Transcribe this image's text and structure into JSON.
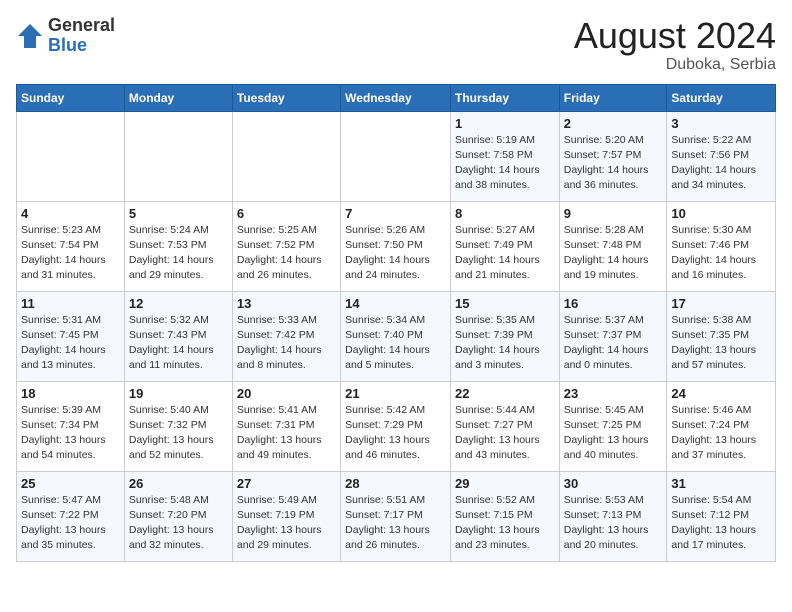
{
  "header": {
    "logo_general": "General",
    "logo_blue": "Blue",
    "month_year": "August 2024",
    "location": "Duboka, Serbia"
  },
  "days_of_week": [
    "Sunday",
    "Monday",
    "Tuesday",
    "Wednesday",
    "Thursday",
    "Friday",
    "Saturday"
  ],
  "weeks": [
    [
      {
        "day": "",
        "info": ""
      },
      {
        "day": "",
        "info": ""
      },
      {
        "day": "",
        "info": ""
      },
      {
        "day": "",
        "info": ""
      },
      {
        "day": "1",
        "info": "Sunrise: 5:19 AM\nSunset: 7:58 PM\nDaylight: 14 hours\nand 38 minutes."
      },
      {
        "day": "2",
        "info": "Sunrise: 5:20 AM\nSunset: 7:57 PM\nDaylight: 14 hours\nand 36 minutes."
      },
      {
        "day": "3",
        "info": "Sunrise: 5:22 AM\nSunset: 7:56 PM\nDaylight: 14 hours\nand 34 minutes."
      }
    ],
    [
      {
        "day": "4",
        "info": "Sunrise: 5:23 AM\nSunset: 7:54 PM\nDaylight: 14 hours\nand 31 minutes."
      },
      {
        "day": "5",
        "info": "Sunrise: 5:24 AM\nSunset: 7:53 PM\nDaylight: 14 hours\nand 29 minutes."
      },
      {
        "day": "6",
        "info": "Sunrise: 5:25 AM\nSunset: 7:52 PM\nDaylight: 14 hours\nand 26 minutes."
      },
      {
        "day": "7",
        "info": "Sunrise: 5:26 AM\nSunset: 7:50 PM\nDaylight: 14 hours\nand 24 minutes."
      },
      {
        "day": "8",
        "info": "Sunrise: 5:27 AM\nSunset: 7:49 PM\nDaylight: 14 hours\nand 21 minutes."
      },
      {
        "day": "9",
        "info": "Sunrise: 5:28 AM\nSunset: 7:48 PM\nDaylight: 14 hours\nand 19 minutes."
      },
      {
        "day": "10",
        "info": "Sunrise: 5:30 AM\nSunset: 7:46 PM\nDaylight: 14 hours\nand 16 minutes."
      }
    ],
    [
      {
        "day": "11",
        "info": "Sunrise: 5:31 AM\nSunset: 7:45 PM\nDaylight: 14 hours\nand 13 minutes."
      },
      {
        "day": "12",
        "info": "Sunrise: 5:32 AM\nSunset: 7:43 PM\nDaylight: 14 hours\nand 11 minutes."
      },
      {
        "day": "13",
        "info": "Sunrise: 5:33 AM\nSunset: 7:42 PM\nDaylight: 14 hours\nand 8 minutes."
      },
      {
        "day": "14",
        "info": "Sunrise: 5:34 AM\nSunset: 7:40 PM\nDaylight: 14 hours\nand 5 minutes."
      },
      {
        "day": "15",
        "info": "Sunrise: 5:35 AM\nSunset: 7:39 PM\nDaylight: 14 hours\nand 3 minutes."
      },
      {
        "day": "16",
        "info": "Sunrise: 5:37 AM\nSunset: 7:37 PM\nDaylight: 14 hours\nand 0 minutes."
      },
      {
        "day": "17",
        "info": "Sunrise: 5:38 AM\nSunset: 7:35 PM\nDaylight: 13 hours\nand 57 minutes."
      }
    ],
    [
      {
        "day": "18",
        "info": "Sunrise: 5:39 AM\nSunset: 7:34 PM\nDaylight: 13 hours\nand 54 minutes."
      },
      {
        "day": "19",
        "info": "Sunrise: 5:40 AM\nSunset: 7:32 PM\nDaylight: 13 hours\nand 52 minutes."
      },
      {
        "day": "20",
        "info": "Sunrise: 5:41 AM\nSunset: 7:31 PM\nDaylight: 13 hours\nand 49 minutes."
      },
      {
        "day": "21",
        "info": "Sunrise: 5:42 AM\nSunset: 7:29 PM\nDaylight: 13 hours\nand 46 minutes."
      },
      {
        "day": "22",
        "info": "Sunrise: 5:44 AM\nSunset: 7:27 PM\nDaylight: 13 hours\nand 43 minutes."
      },
      {
        "day": "23",
        "info": "Sunrise: 5:45 AM\nSunset: 7:25 PM\nDaylight: 13 hours\nand 40 minutes."
      },
      {
        "day": "24",
        "info": "Sunrise: 5:46 AM\nSunset: 7:24 PM\nDaylight: 13 hours\nand 37 minutes."
      }
    ],
    [
      {
        "day": "25",
        "info": "Sunrise: 5:47 AM\nSunset: 7:22 PM\nDaylight: 13 hours\nand 35 minutes."
      },
      {
        "day": "26",
        "info": "Sunrise: 5:48 AM\nSunset: 7:20 PM\nDaylight: 13 hours\nand 32 minutes."
      },
      {
        "day": "27",
        "info": "Sunrise: 5:49 AM\nSunset: 7:19 PM\nDaylight: 13 hours\nand 29 minutes."
      },
      {
        "day": "28",
        "info": "Sunrise: 5:51 AM\nSunset: 7:17 PM\nDaylight: 13 hours\nand 26 minutes."
      },
      {
        "day": "29",
        "info": "Sunrise: 5:52 AM\nSunset: 7:15 PM\nDaylight: 13 hours\nand 23 minutes."
      },
      {
        "day": "30",
        "info": "Sunrise: 5:53 AM\nSunset: 7:13 PM\nDaylight: 13 hours\nand 20 minutes."
      },
      {
        "day": "31",
        "info": "Sunrise: 5:54 AM\nSunset: 7:12 PM\nDaylight: 13 hours\nand 17 minutes."
      }
    ]
  ]
}
